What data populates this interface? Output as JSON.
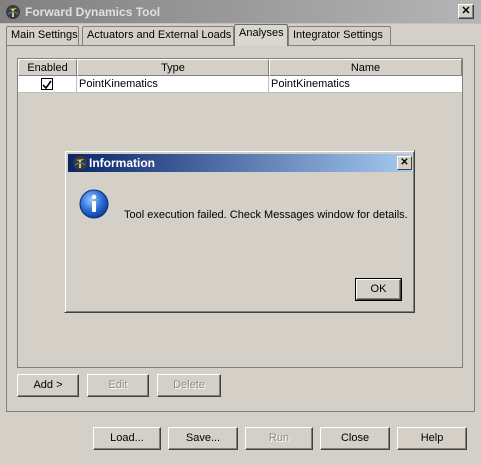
{
  "window": {
    "title": "Forward Dynamics Tool",
    "close_glyph": "✕",
    "app_icon": "opensim-app-icon"
  },
  "tabs": [
    {
      "label": "Main Settings",
      "selected": false
    },
    {
      "label": "Actuators and External Loads",
      "selected": false
    },
    {
      "label": "Analyses",
      "selected": true
    },
    {
      "label": "Integrator Settings",
      "selected": false
    }
  ],
  "table": {
    "headers": [
      "Enabled",
      "Type",
      "Name"
    ],
    "rows": [
      {
        "enabled": true,
        "type": "PointKinematics",
        "name": "PointKinematics"
      }
    ]
  },
  "analyses_buttons": {
    "add": "Add >",
    "edit": "Edit",
    "delete": "Delete"
  },
  "footer_buttons": {
    "load": "Load...",
    "save": "Save...",
    "run": "Run",
    "close": "Close",
    "help": "Help"
  },
  "dialog": {
    "title": "Information",
    "close_glyph": "✕",
    "message": "Tool execution failed. Check Messages window for details.",
    "ok": "OK",
    "icon": "info-icon"
  },
  "colors": {
    "dialog_title_start": "#0a246a",
    "dialog_title_end": "#a6caf0",
    "window_bg": "#d4d0c8"
  }
}
